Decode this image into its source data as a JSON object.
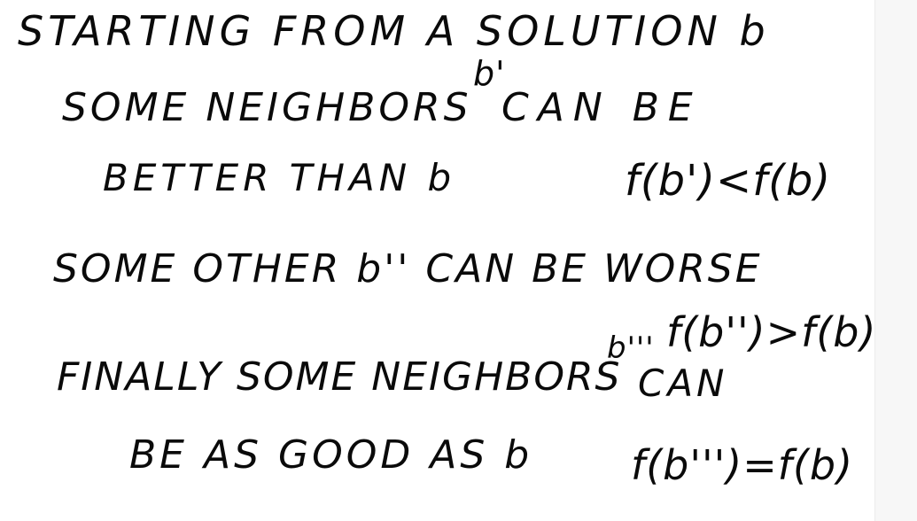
{
  "note": {
    "line1": "STARTING FROM A SOLUTION b",
    "line2a": "SOME NEIGHBORS",
    "line2_sup": "b'",
    "line2b": "CAN BE",
    "line3a": "BETTER THAN b",
    "line3_math": "f(b')<f(b)",
    "line4": "SOME OTHER b'' CAN BE WORSE",
    "line5_math": "f(b'')>f(b)",
    "line6a": "FINALLY SOME NEIGHBORS",
    "line6_sup": "b'''",
    "line6b": "CAN",
    "line7a": "BE AS GOOD AS b",
    "line7_math": "f(b''')=f(b)"
  }
}
